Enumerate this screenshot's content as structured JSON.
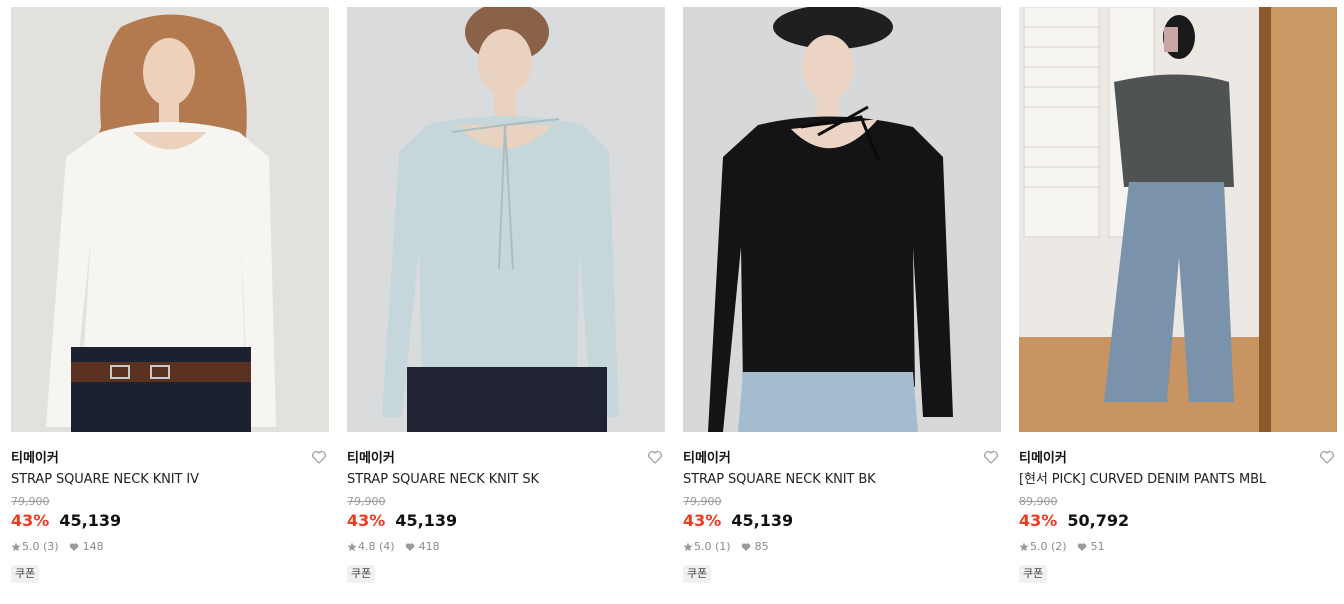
{
  "products": [
    {
      "brand": "티메이커",
      "name": "STRAP SQUARE NECK KNIT IV",
      "original_price": "79,900",
      "discount": "43%",
      "price": "45,139",
      "rating": "5.0 (3)",
      "likes": "148",
      "badge": "쿠폰",
      "image": "model-white-knit"
    },
    {
      "brand": "티메이커",
      "name": "STRAP SQUARE NECK KNIT SK",
      "original_price": "79,900",
      "discount": "43%",
      "price": "45,139",
      "rating": "4.8 (4)",
      "likes": "418",
      "badge": "쿠폰",
      "image": "model-skyblue-knit"
    },
    {
      "brand": "티메이커",
      "name": "STRAP SQUARE NECK KNIT BK",
      "original_price": "79,900",
      "discount": "43%",
      "price": "45,139",
      "rating": "5.0 (1)",
      "likes": "85",
      "badge": "쿠폰",
      "image": "model-black-knit"
    },
    {
      "brand": "티메이커",
      "name": "[현서 PICK] CURVED DENIM PANTS MBL",
      "original_price": "89,900",
      "discount": "43%",
      "price": "50,792",
      "rating": "5.0 (2)",
      "likes": "51",
      "badge": "쿠폰",
      "image": "model-denim-pants-mirror-selfie"
    }
  ],
  "colors": {
    "discount": "#ee3a1c",
    "price": "#111111",
    "muted": "#8a8a8a"
  },
  "icons": {
    "wishlist": "heart-outline-icon",
    "rating": "star-icon",
    "likes": "heart-filled-icon"
  }
}
